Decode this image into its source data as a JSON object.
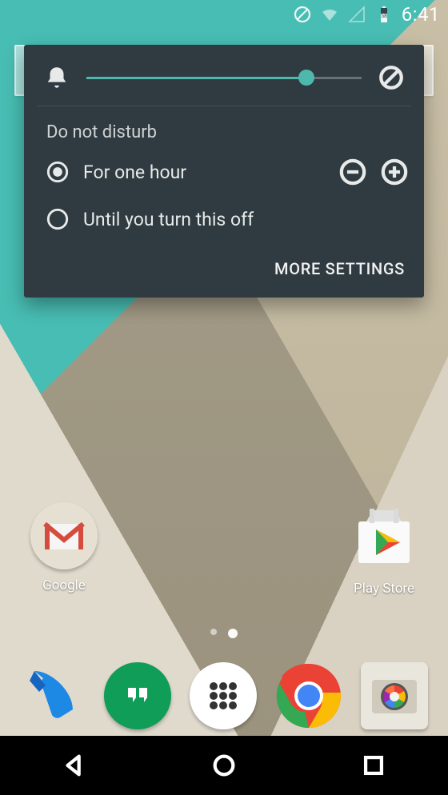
{
  "status": {
    "clock": "6:41",
    "battery_level": "58"
  },
  "card": {
    "volume_percent": 80,
    "section_title": "Do not disturb",
    "options": [
      {
        "label": "For one hour",
        "selected": true,
        "adjustable": true
      },
      {
        "label": "Until you turn this off",
        "selected": false,
        "adjustable": false
      }
    ],
    "more_label": "MORE SETTINGS"
  },
  "apps": [
    {
      "id": "google",
      "label": "Google"
    },
    {
      "id": "play-store",
      "label": "Play Store"
    }
  ],
  "dock": [
    {
      "id": "phone"
    },
    {
      "id": "hangouts"
    },
    {
      "id": "app-drawer"
    },
    {
      "id": "chrome"
    },
    {
      "id": "camera"
    }
  ],
  "colors": {
    "card_bg": "#2f3b40",
    "accent": "#4fb8ad"
  }
}
